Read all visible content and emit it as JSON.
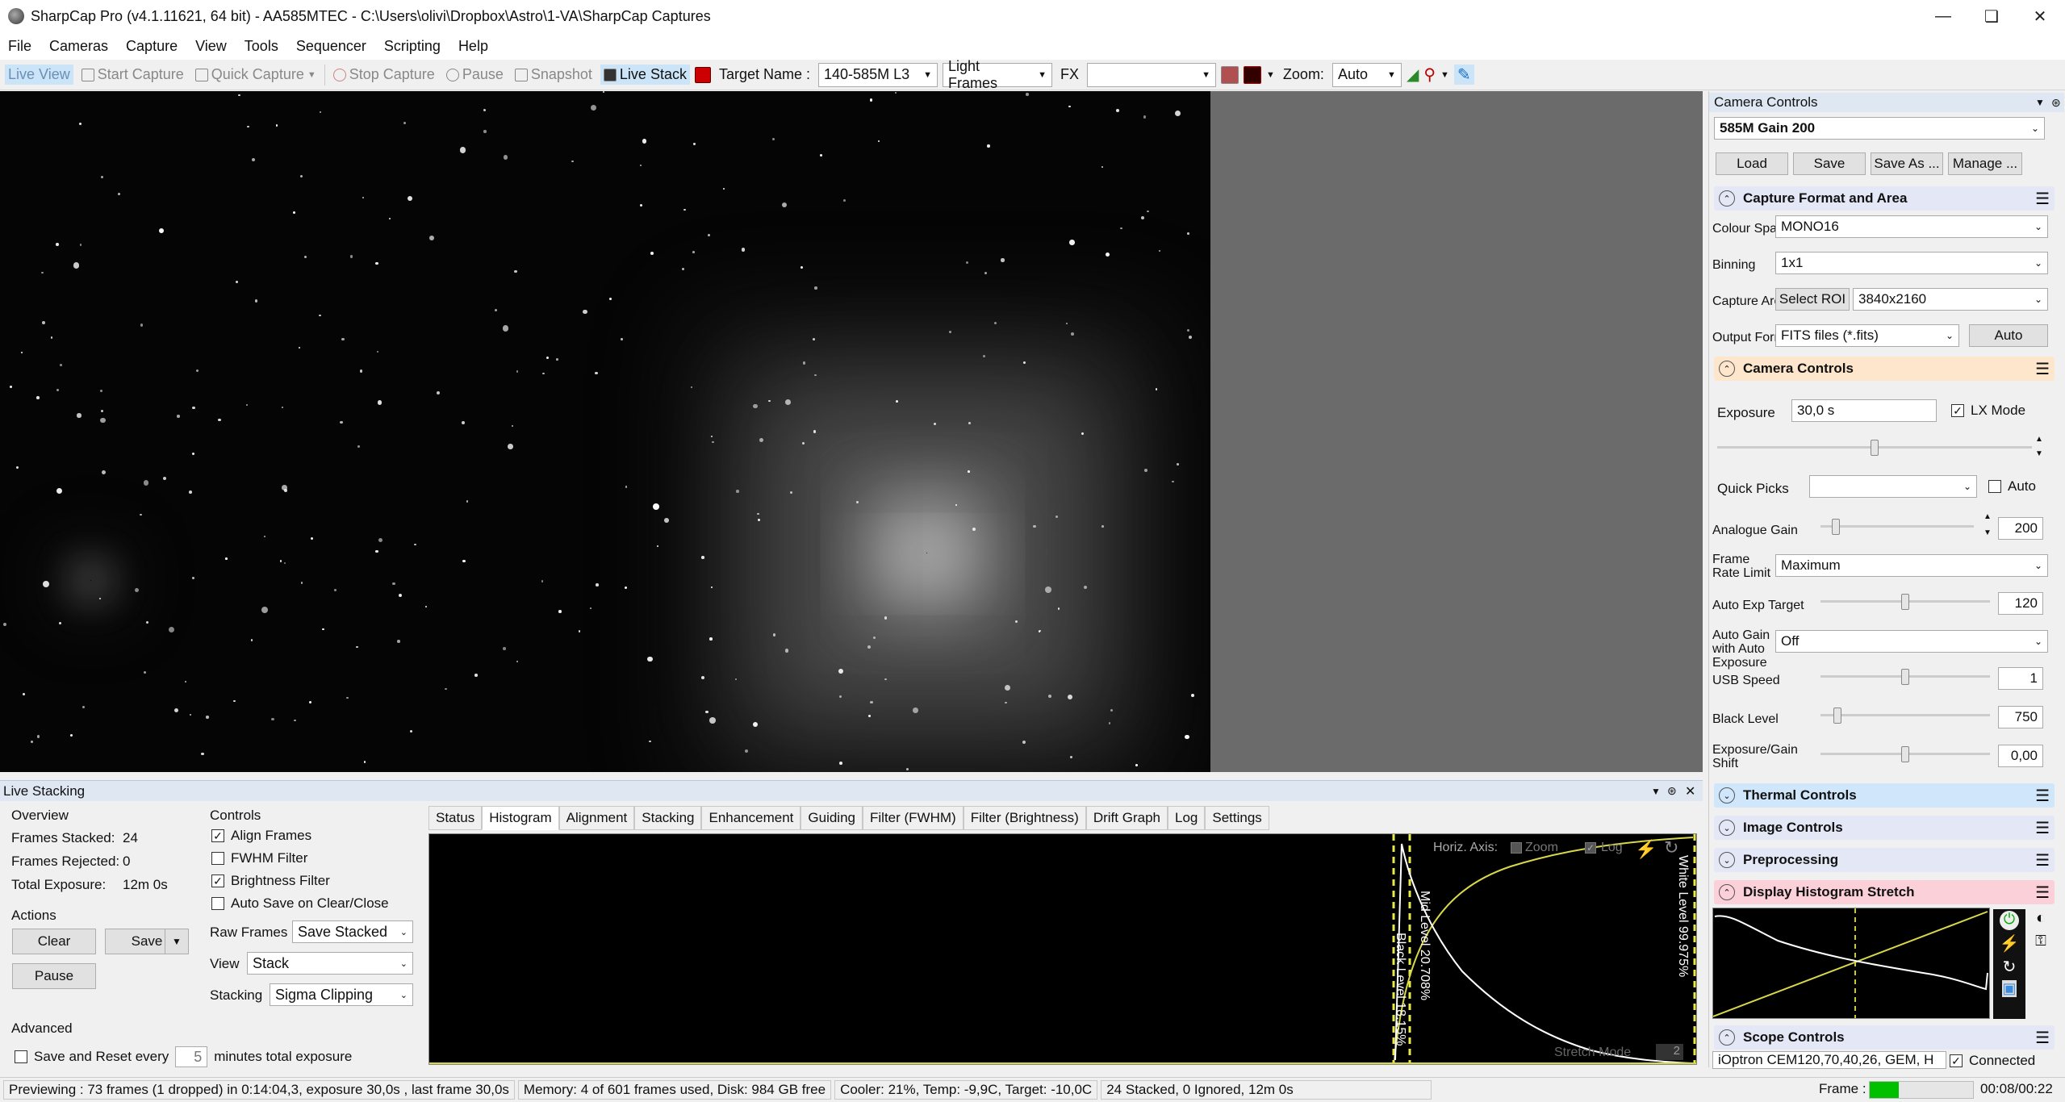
{
  "window": {
    "title": "SharpCap Pro (v4.1.11621, 64 bit) - AA585MTEC - C:\\Users\\olivi\\Dropbox\\Astro\\1-VA\\SharpCap Captures"
  },
  "menu": [
    "File",
    "Cameras",
    "Capture",
    "View",
    "Tools",
    "Sequencer",
    "Scripting",
    "Help"
  ],
  "toolbar": {
    "live_view": "Live View",
    "start_capture": "Start Capture",
    "quick_capture": "Quick Capture",
    "stop_capture": "Stop Capture",
    "pause": "Pause",
    "snapshot": "Snapshot",
    "live_stack": "Live Stack",
    "target_name_label": "Target Name :",
    "target_name_value": "140-585M L3",
    "frame_type": "Light Frames",
    "fx_label": "FX",
    "fx_value": "",
    "zoom_label": "Zoom:",
    "zoom_value": "Auto"
  },
  "live_stacking": {
    "title": "Live Stacking",
    "overview": {
      "title": "Overview",
      "frames_stacked_label": "Frames Stacked:",
      "frames_stacked": "24",
      "frames_rejected_label": "Frames Rejected:",
      "frames_rejected": "0",
      "total_exposure_label": "Total Exposure:",
      "total_exposure": "12m 0s"
    },
    "actions": {
      "title": "Actions",
      "clear": "Clear",
      "save": "Save",
      "pause": "Pause"
    },
    "advanced": {
      "title": "Advanced",
      "save_reset_label": "Save and Reset every",
      "save_reset_value": "5",
      "save_reset_suffix": "minutes total exposure"
    },
    "controls": {
      "title": "Controls",
      "align_frames": "Align Frames",
      "fwhm_filter": "FWHM Filter",
      "brightness_filter": "Brightness Filter",
      "auto_save": "Auto Save on Clear/Close",
      "raw_frames_label": "Raw Frames",
      "raw_frames_value": "Save Stacked",
      "view_label": "View",
      "view_value": "Stack",
      "stacking_label": "Stacking",
      "stacking_value": "Sigma Clipping"
    },
    "tabs": [
      "Status",
      "Histogram",
      "Alignment",
      "Stacking",
      "Enhancement",
      "Guiding",
      "Filter (FWHM)",
      "Filter (Brightness)",
      "Drift Graph",
      "Log",
      "Settings"
    ],
    "histogram": {
      "horiz_axis_label": "Horiz. Axis:",
      "zoom_label": "Zoom",
      "log_label": "Log",
      "black_level": "Black Level 18.15%",
      "mid_level": "Mid Level 20.708%",
      "white_level": "White Level 99.975%",
      "stretch_mode_label": "Stretch Mode",
      "stretch_mode_value": "2"
    }
  },
  "camera_panel": {
    "title": "Camera Controls",
    "profile": "585M Gain 200",
    "load": "Load",
    "save": "Save",
    "save_as": "Save As ...",
    "manage": "Manage ...",
    "capture_format": {
      "title": "Capture Format and Area",
      "colour_space_label": "Colour Space",
      "colour_space": "MONO16",
      "binning_label": "Binning",
      "binning": "1x1",
      "capture_area_label": "Capture Area",
      "select_roi": "Select ROI",
      "capture_area": "3840x2160",
      "output_format_label": "Output Format",
      "output_format": "FITS files (*.fits)",
      "auto": "Auto"
    },
    "camera_controls": {
      "title": "Camera Controls",
      "exposure_label": "Exposure",
      "exposure": "30,0 s",
      "lx_mode": "LX Mode",
      "quick_picks_label": "Quick Picks",
      "quick_picks_auto": "Auto",
      "analogue_gain_label": "Analogue Gain",
      "analogue_gain": "200",
      "frame_rate_label": "Frame Rate Limit",
      "frame_rate": "Maximum",
      "auto_exp_target_label": "Auto Exp Target",
      "auto_exp_target": "120",
      "auto_gain_label": "Auto Gain with Auto Exposure",
      "auto_gain": "Off",
      "usb_speed_label": "USB Speed",
      "usb_speed": "1",
      "black_level_label": "Black Level",
      "black_level": "750",
      "exp_gain_shift_label": "Exposure/Gain Shift",
      "exp_gain_shift": "0,00"
    },
    "thermal": "Thermal Controls",
    "image_controls": "Image Controls",
    "preprocessing": "Preprocessing",
    "display_stretch": "Display Histogram Stretch",
    "scope_controls": "Scope Controls",
    "mount": "iOptron CEM120,70,40,26, GEM, H",
    "connected": "Connected"
  },
  "sliders": {
    "exposure": 0.5,
    "analogue_gain": 0.1,
    "auto_exp_target": 0.5,
    "usb_speed": 0.5,
    "black_level": 0.1,
    "exp_gain_shift": 0.5
  },
  "status": {
    "preview": "Previewing : 73 frames (1 dropped) in 0:14:04,3, exposure 30,0s , last frame 30,0s",
    "memory": "Memory: 4 of 601 frames used, Disk: 984 GB free",
    "cooler": "Cooler: 21%, Temp: -9,9C, Target: -10,0C",
    "stacked": "24 Stacked, 0 Ignored, 12m 0s",
    "frame_label": "Frame :",
    "elapsed": "00:08/00:22"
  },
  "colors": {
    "accent": "#cce4f7",
    "camera_section": "#fde6cc",
    "thermal_section": "#cfe6fb",
    "display_section": "#fbd0d9",
    "scope_section": "#e3e7f6",
    "frame_progress": "#00c000"
  }
}
